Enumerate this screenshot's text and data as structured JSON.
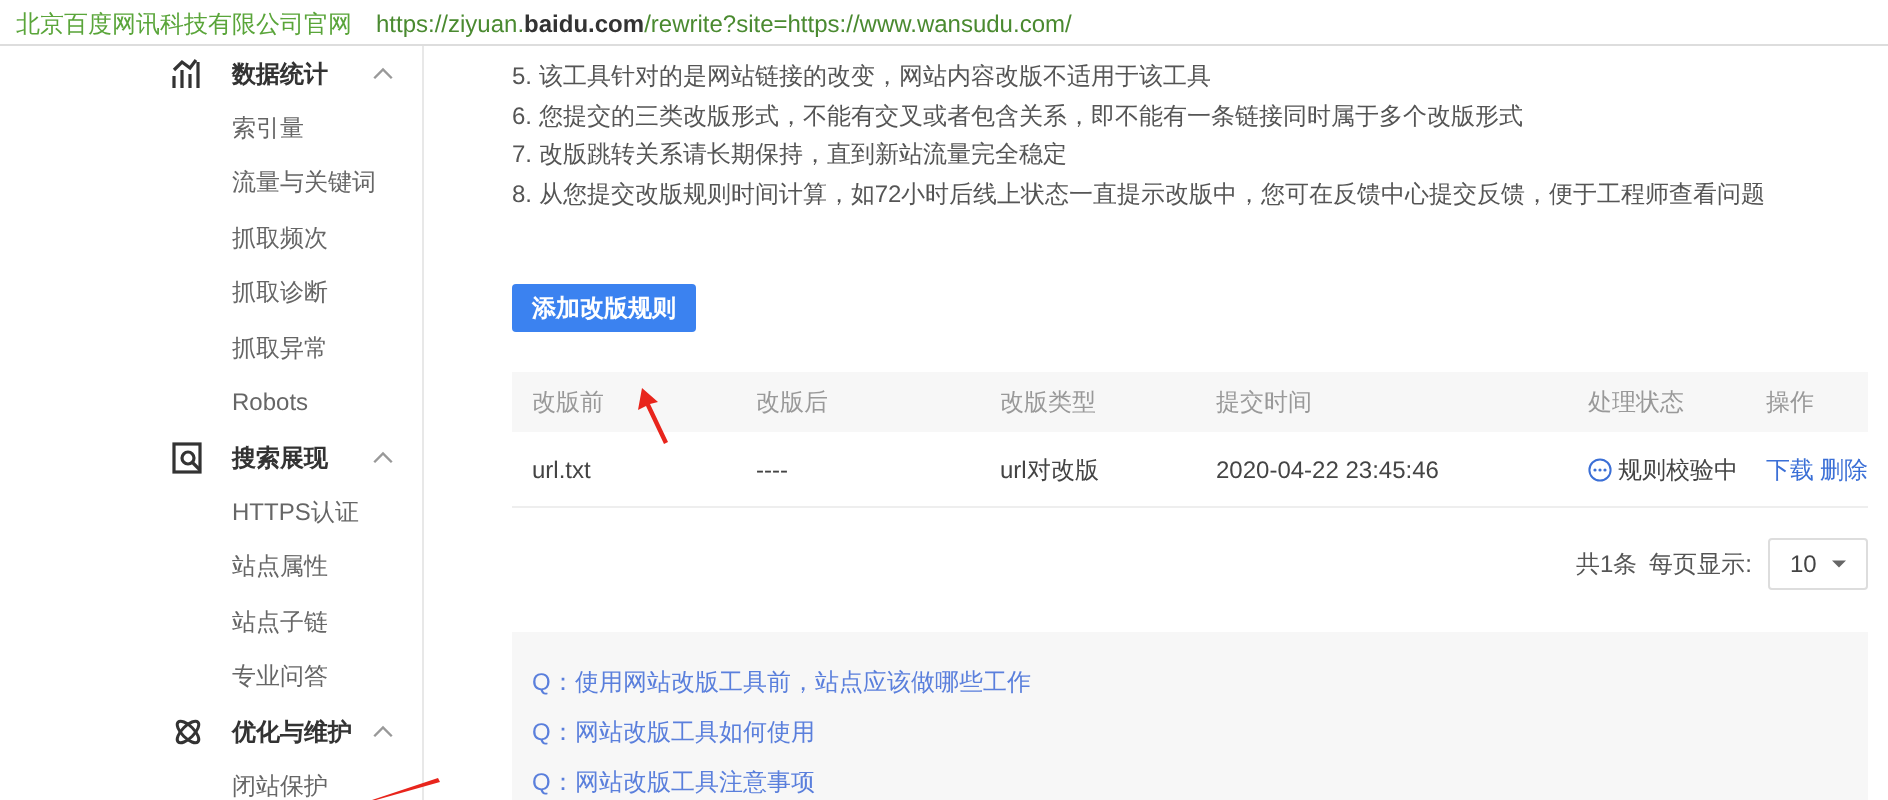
{
  "address_bar": {
    "site_name": "北京百度网讯科技有限公司官网",
    "url": "https://ziyuan.**baidu.com**/rewrite?site=https://www.wansudu.com/"
  },
  "sidebar": {
    "groups": [
      {
        "title": "数据统计",
        "expanded": true,
        "items": [
          "索引量",
          "流量与关键词",
          "抓取频次",
          "抓取诊断",
          "抓取异常",
          "Robots"
        ]
      },
      {
        "title": "搜索展现",
        "expanded": true,
        "items": [
          "HTTPS认证",
          "站点属性",
          "站点子链",
          "专业问答"
        ]
      },
      {
        "title": "优化与维护",
        "expanded": true,
        "items": [
          "闭站保护"
        ]
      }
    ]
  },
  "notes": [
    "5. 该工具针对的是网站链接的改变，网站内容改版不适用于该工具",
    "6. 您提交的三类改版形式，不能有交叉或者包含关系，即不能有一条链接同时属于多个改版形式",
    "7. 改版跳转关系请长期保持，直到新站流量完全稳定",
    "8. 从您提交改版规则时间计算，如72小时后线上状态一直提示改版中，您可在反馈中心提交反馈，便于工程师查看问题"
  ],
  "add_button": "添加改版规则",
  "table": {
    "columns": [
      "改版前",
      "改版后",
      "改版类型",
      "提交时间",
      "处理状态",
      "操作"
    ],
    "rows": [
      {
        "before": "url.txt",
        "after": "----",
        "type": "url对改版",
        "time": "2020-04-22 23:45:46",
        "status": "规则校验中",
        "actions": [
          "下载",
          "删除"
        ]
      }
    ]
  },
  "pagination": {
    "total": "共1条",
    "per_page_label": "每页显示:",
    "per_page": "10"
  },
  "faq": [
    "Q：使用网站改版工具前，站点应该做哪些工作",
    "Q：网站改版工具如何使用",
    "Q：网站改版工具注意事项"
  ]
}
